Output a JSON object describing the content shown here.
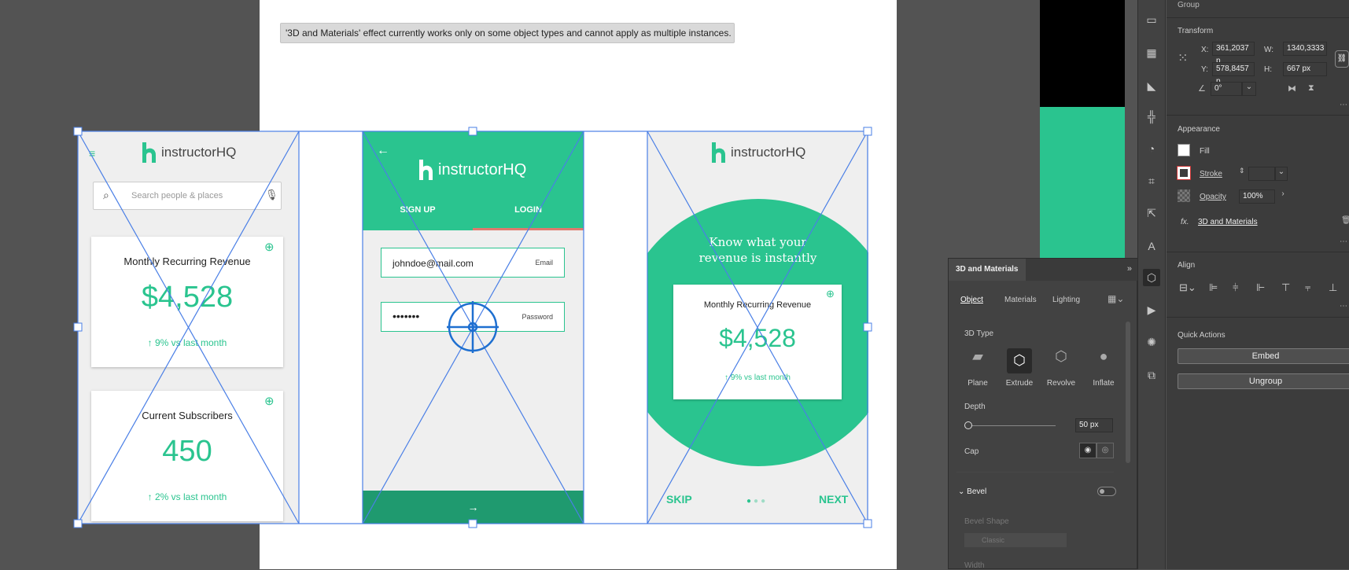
{
  "tooltip": "'3D and Materials' effect currently works only on some object types and cannot apply as multiple instances.",
  "screen1": {
    "logo": "instructorHQ",
    "search_placeholder": "Search people & places",
    "card1": {
      "title": "Monthly Recurring Revenue",
      "value": "$4,528",
      "change": "9% vs last month"
    },
    "card2": {
      "title": "Current Subscribers",
      "value": "450",
      "change": "2% vs last month"
    }
  },
  "screen2": {
    "logo": "instructorHQ",
    "tab_signup": "SIGN UP",
    "tab_login": "LOGIN",
    "email_value": "johndoe@mail.com",
    "email_label": "Email",
    "password_value": "•••••••",
    "password_label": "Password"
  },
  "screen3": {
    "logo": "instructorHQ",
    "headline1": "Know what your",
    "headline2": "revenue is instantly",
    "card": {
      "title": "Monthly Recurring Revenue",
      "value": "$4,528",
      "change": "9% vs last month"
    },
    "skip": "SKIP",
    "next": "NEXT"
  },
  "panel3d": {
    "title": "3D and Materials",
    "tabs": [
      "Object",
      "Materials",
      "Lighting"
    ],
    "type_label": "3D Type",
    "types": [
      "Plane",
      "Extrude",
      "Revolve",
      "Inflate"
    ],
    "depth_label": "Depth",
    "depth_value": "50 px",
    "cap_label": "Cap",
    "bevel_label": "Bevel",
    "bevel_shape_label": "Bevel Shape",
    "bevel_shape_value": "Classic",
    "width_label": "Width"
  },
  "props": {
    "group_label": "Group",
    "transform_label": "Transform",
    "x_label": "X:",
    "x_value": "361,2037 p",
    "y_label": "Y:",
    "y_value": "578,8457 p",
    "w_label": "W:",
    "w_value": "1340,3333",
    "h_label": "H:",
    "h_value": "667 px",
    "angle_value": "0°",
    "appearance_label": "Appearance",
    "fill_label": "Fill",
    "stroke_label": "Stroke",
    "opacity_label": "Opacity",
    "opacity_value": "100%",
    "fx_label": "fx.",
    "effect_label": "3D and Materials",
    "align_label": "Align",
    "quick_label": "Quick Actions",
    "embed_label": "Embed",
    "ungroup_label": "Ungroup"
  },
  "colors": {
    "teal": "#2ac48f",
    "teal_dark": "#1f9a6f",
    "selection": "#4a7fe6"
  }
}
